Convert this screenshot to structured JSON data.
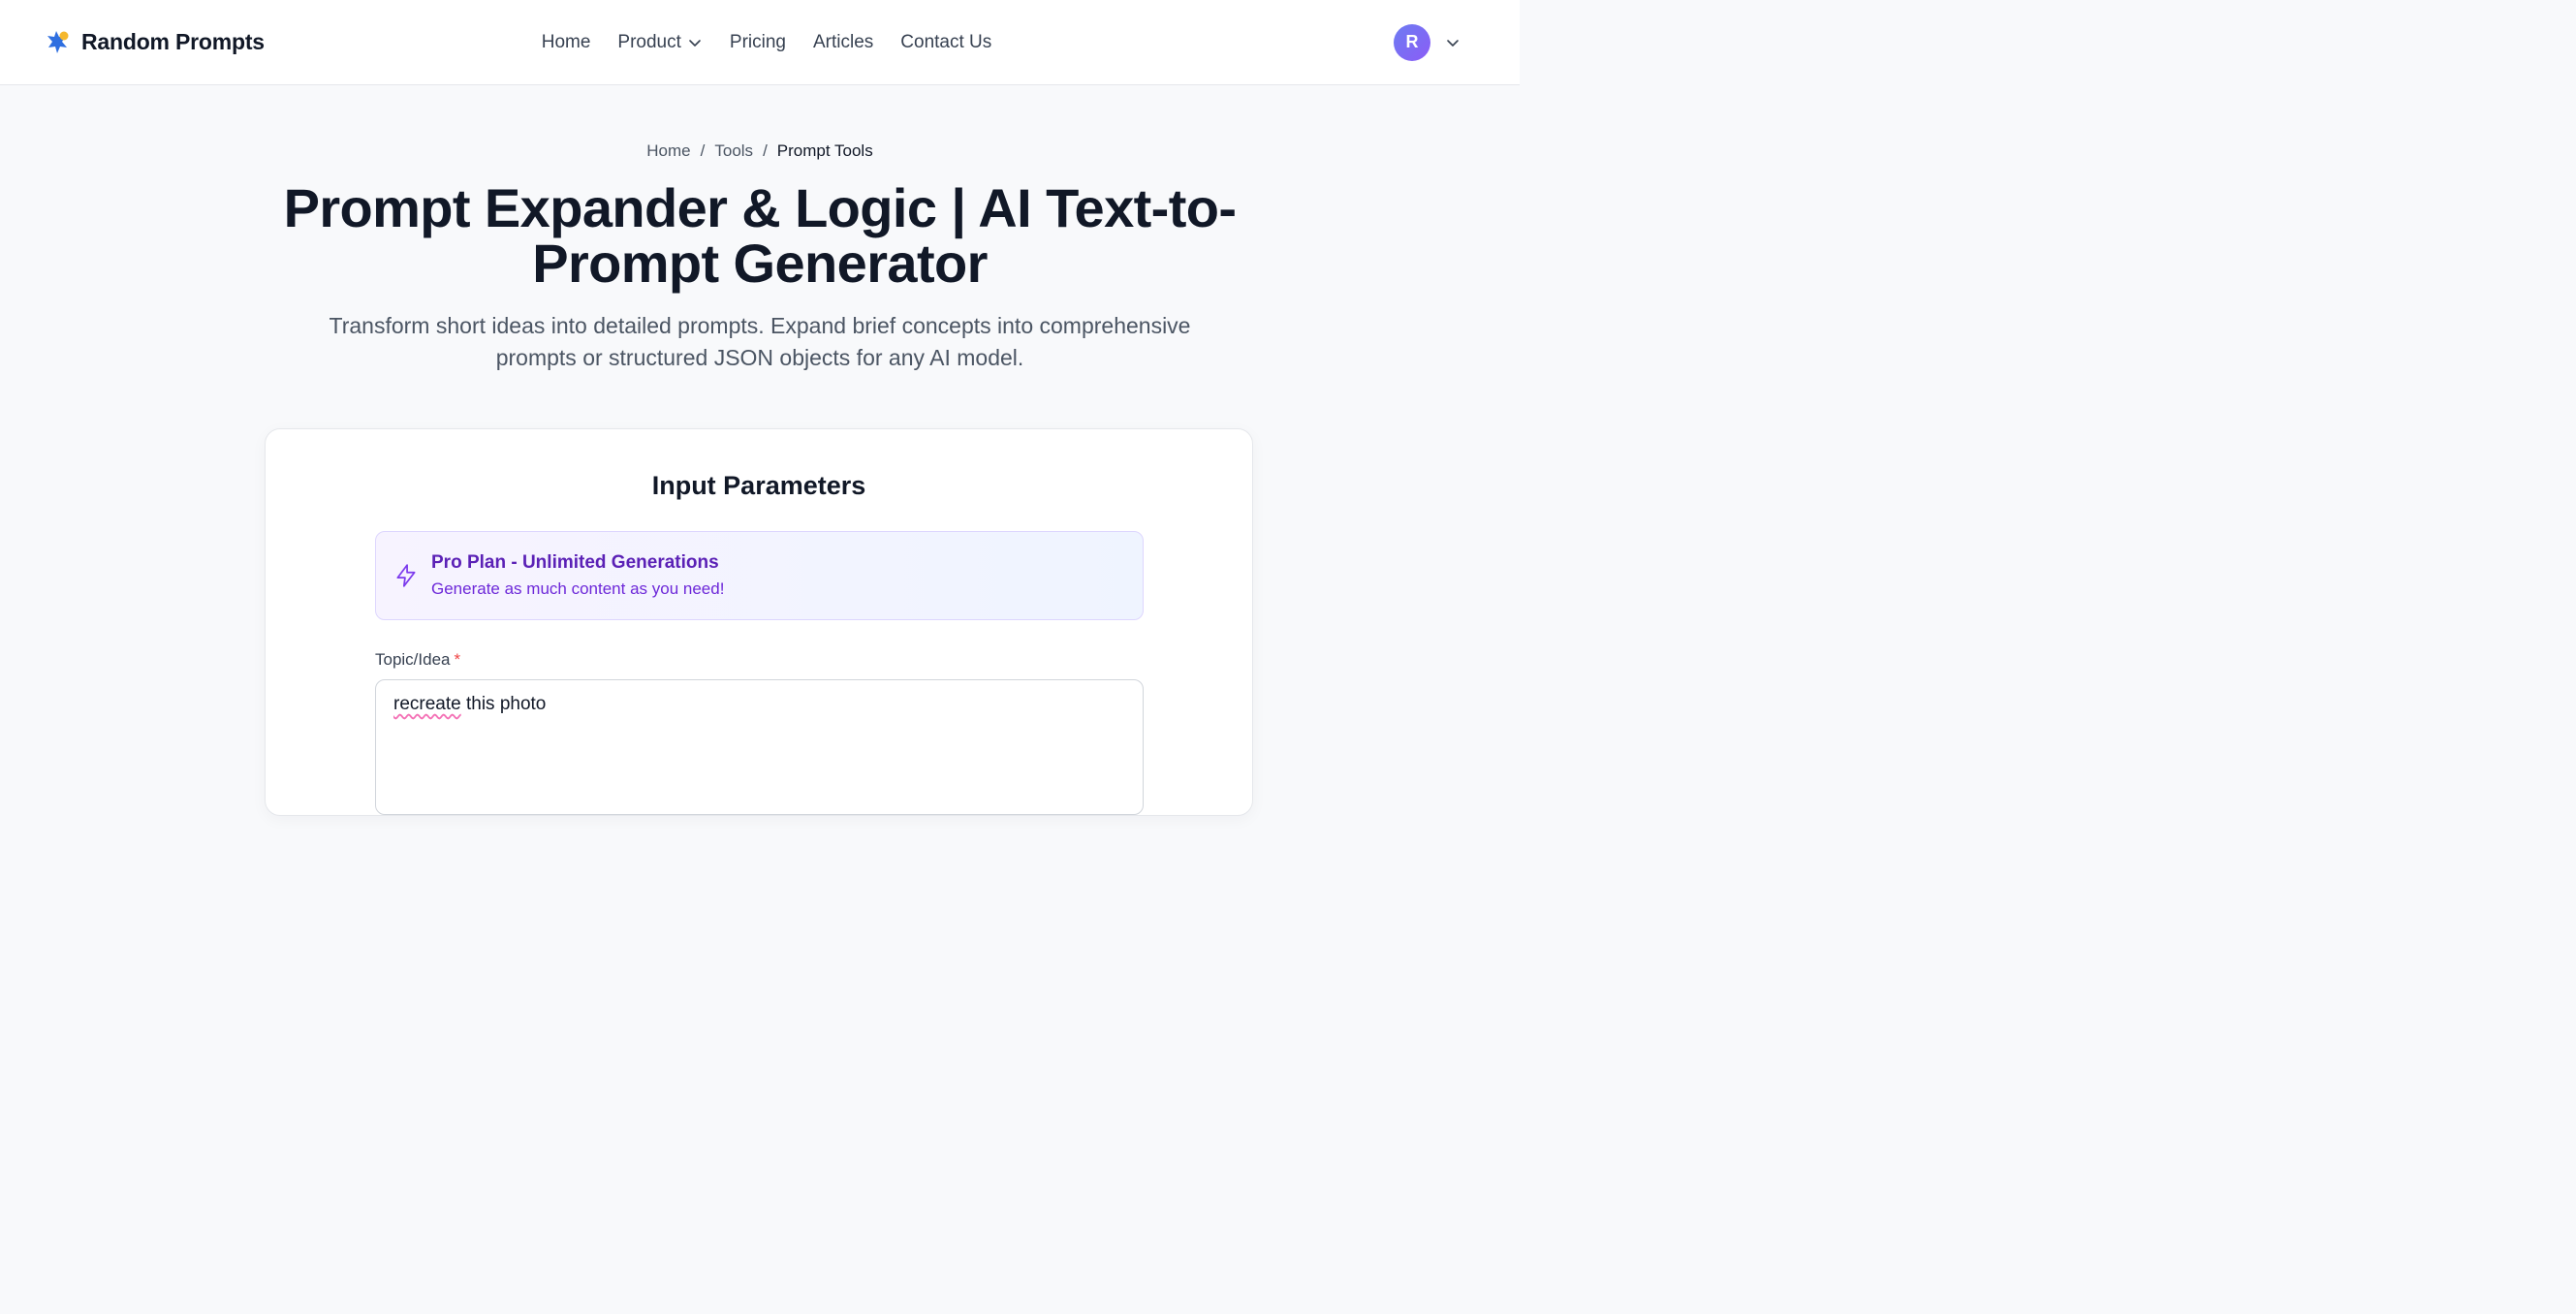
{
  "brand": {
    "name": "Random Prompts"
  },
  "nav": {
    "items": [
      {
        "label": "Home"
      },
      {
        "label": "Product"
      },
      {
        "label": "Pricing"
      },
      {
        "label": "Articles"
      },
      {
        "label": "Contact Us"
      }
    ]
  },
  "account": {
    "initial": "R"
  },
  "breadcrumb": {
    "items": [
      "Home",
      "Tools",
      "Prompt Tools"
    ],
    "separator": "/"
  },
  "page": {
    "title": "Prompt Expander & Logic | AI Text-to-Prompt Generator",
    "subtitle": "Transform short ideas into detailed prompts. Expand brief concepts into comprehensive prompts or structured JSON objects for any AI model."
  },
  "card": {
    "title": "Input Parameters",
    "plan": {
      "title": "Pro Plan - Unlimited Generations",
      "description": "Generate as much content as you need!"
    },
    "topic": {
      "label": "Topic/Idea",
      "required_mark": "*",
      "value_word1": "recreate",
      "value_rest": " this photo"
    }
  },
  "colors": {
    "accent": "#6d28d9",
    "avatar": "#7c6cf3",
    "required": "#ef4444"
  },
  "icons": {
    "logo": "puzzle-star-icon",
    "product_dropdown": "chevron-down-icon",
    "account_dropdown": "chevron-down-icon",
    "plan": "bolt-icon"
  }
}
